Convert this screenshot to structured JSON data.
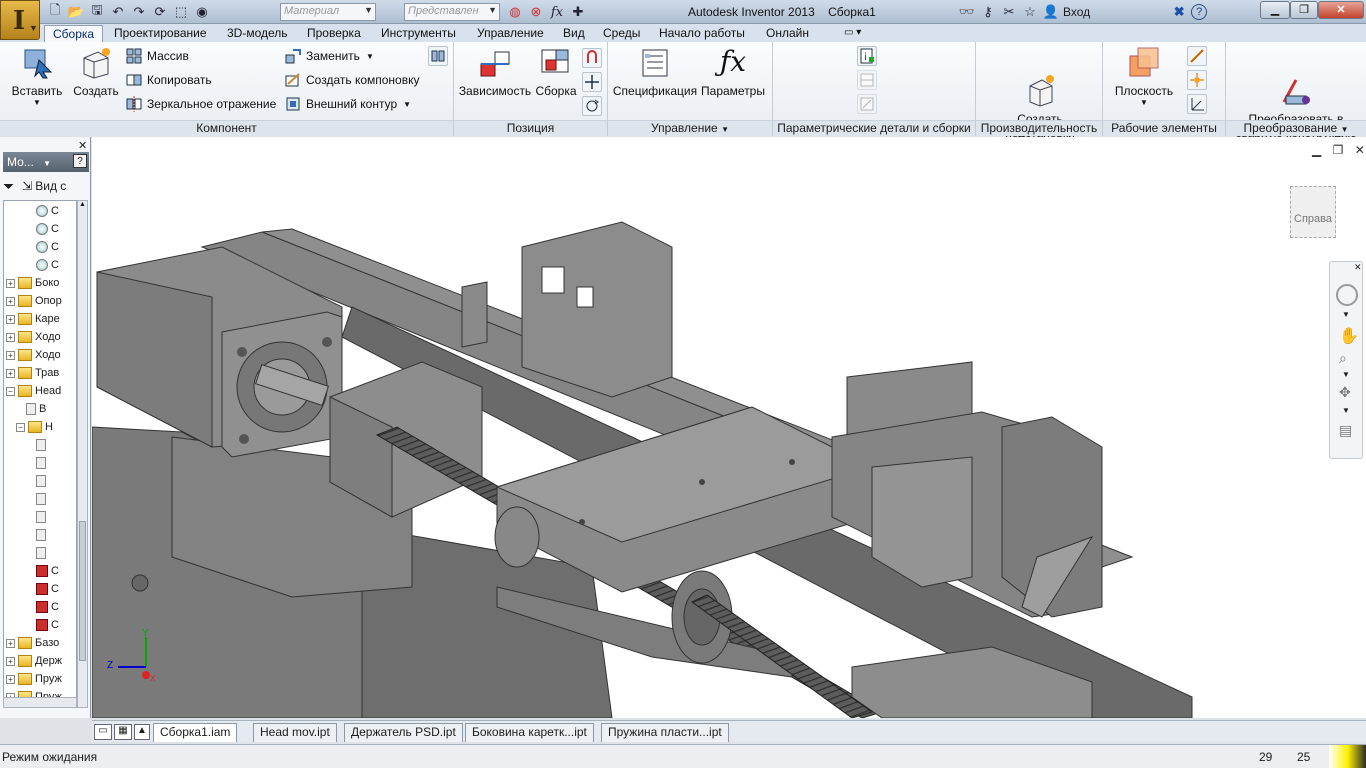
{
  "titlebar": {
    "title": "Autodesk Inventor 2013    Сборка1",
    "app_letter": "I",
    "material_placeholder": "Материал",
    "representation_placeholder": "Представлен",
    "fx_label": "fx",
    "signin_label": "Вход",
    "icons": [
      "new-icon",
      "open-icon",
      "save-icon",
      "undo-icon",
      "redo-icon",
      "update-icon",
      "select-icon",
      "color-wheel-icon",
      "appearance-override-icon",
      "clear-override-icon",
      "parameters-fx-icon",
      "measure-icon",
      "binoculars-icon",
      "key-icon",
      "share-icon",
      "star-icon",
      "user-icon",
      "x-exchange-icon",
      "help-icon"
    ]
  },
  "ribbon_tabs": [
    "Сборка",
    "Проектирование",
    "3D-модель",
    "Проверка",
    "Инструменты",
    "Управление",
    "Вид",
    "Среды",
    "Начало работы",
    "Онлайн"
  ],
  "ribbon": {
    "component": {
      "label": "Компонент",
      "insert": "Вставить",
      "create": "Создать",
      "pattern": "Массив",
      "copy": "Копировать",
      "mirror": "Зеркальное отражение",
      "replace": "Заменить",
      "create_layout": "Создать компоновку",
      "shrinkwrap": "Внешний контур"
    },
    "position": {
      "label": "Позиция",
      "constrain": "Зависимость",
      "assemble": "Сборка"
    },
    "manage": {
      "label": "Управление",
      "bom": "Спецификация",
      "parameters": "Параметры"
    },
    "ipart": {
      "label": "Параметрические детали и сборки"
    },
    "productivity": {
      "label": "Производительность",
      "create_sub": "Создать\nподстановки"
    },
    "work_features": {
      "label": "Рабочие элементы",
      "plane": "Плоскость"
    },
    "convert": {
      "label": "Преобразование",
      "to_weldment": "Преобразовать в\nсварную конструкцию"
    }
  },
  "browser": {
    "title": "Мо...",
    "help": "?",
    "view_label": "Вид с",
    "nodes": [
      {
        "indent": 3,
        "icon": "cons",
        "label": "С",
        "expand": ""
      },
      {
        "indent": 3,
        "icon": "cons",
        "label": "С",
        "expand": ""
      },
      {
        "indent": 3,
        "icon": "cons",
        "label": "С",
        "expand": ""
      },
      {
        "indent": 3,
        "icon": "cons",
        "label": "С",
        "expand": ""
      },
      {
        "indent": 0,
        "icon": "folder",
        "label": "Боко",
        "expand": "+"
      },
      {
        "indent": 0,
        "icon": "folder",
        "label": "Опор",
        "expand": "+"
      },
      {
        "indent": 0,
        "icon": "folder",
        "label": "Каре",
        "expand": "+"
      },
      {
        "indent": 0,
        "icon": "folder",
        "label": "Ходо",
        "expand": "+"
      },
      {
        "indent": 0,
        "icon": "folder",
        "label": "Ходо",
        "expand": "+"
      },
      {
        "indent": 0,
        "icon": "folder",
        "label": "Трав",
        "expand": "+"
      },
      {
        "indent": 0,
        "icon": "folder",
        "label": "Head",
        "expand": "−"
      },
      {
        "indent": 2,
        "icon": "leaf",
        "label": "В",
        "expand": ""
      },
      {
        "indent": 1,
        "icon": "folder",
        "label": "Н",
        "expand": "−"
      },
      {
        "indent": 3,
        "icon": "leaf",
        "label": "",
        "expand": ""
      },
      {
        "indent": 3,
        "icon": "leaf",
        "label": "",
        "expand": ""
      },
      {
        "indent": 3,
        "icon": "leaf",
        "label": "",
        "expand": ""
      },
      {
        "indent": 3,
        "icon": "leaf",
        "label": "",
        "expand": ""
      },
      {
        "indent": 3,
        "icon": "leaf",
        "label": "",
        "expand": ""
      },
      {
        "indent": 3,
        "icon": "leaf",
        "label": "",
        "expand": ""
      },
      {
        "indent": 3,
        "icon": "leaf",
        "label": "",
        "expand": ""
      },
      {
        "indent": 3,
        "icon": "part",
        "label": "С",
        "expand": ""
      },
      {
        "indent": 3,
        "icon": "part",
        "label": "С",
        "expand": ""
      },
      {
        "indent": 3,
        "icon": "part",
        "label": "С",
        "expand": ""
      },
      {
        "indent": 3,
        "icon": "part",
        "label": "С",
        "expand": ""
      },
      {
        "indent": 0,
        "icon": "folder",
        "label": "Базо",
        "expand": "+"
      },
      {
        "indent": 0,
        "icon": "folder",
        "label": "Держ",
        "expand": "+"
      },
      {
        "indent": 0,
        "icon": "folder",
        "label": "Пруж",
        "expand": "+"
      },
      {
        "indent": 0,
        "icon": "folder",
        "label": "Пруж",
        "expand": "+"
      }
    ]
  },
  "viewport": {
    "viewcube_label": "Справа",
    "axis_z": "Z",
    "axis_y": "Y",
    "axis_x": "X"
  },
  "doc_tabs": [
    "Сборка1.iam",
    "Head mov.ipt",
    "Держатель PSD.ipt",
    "Боковина каретк...ipt",
    "Пружина пласти...ipt"
  ],
  "status": {
    "text": "Режим ожидания",
    "count1": "29",
    "count2": "25"
  },
  "colors": {
    "accent": "#0b2c6d",
    "model_gray": "#7e7e7e",
    "viewport_bg": "#ffffff"
  }
}
